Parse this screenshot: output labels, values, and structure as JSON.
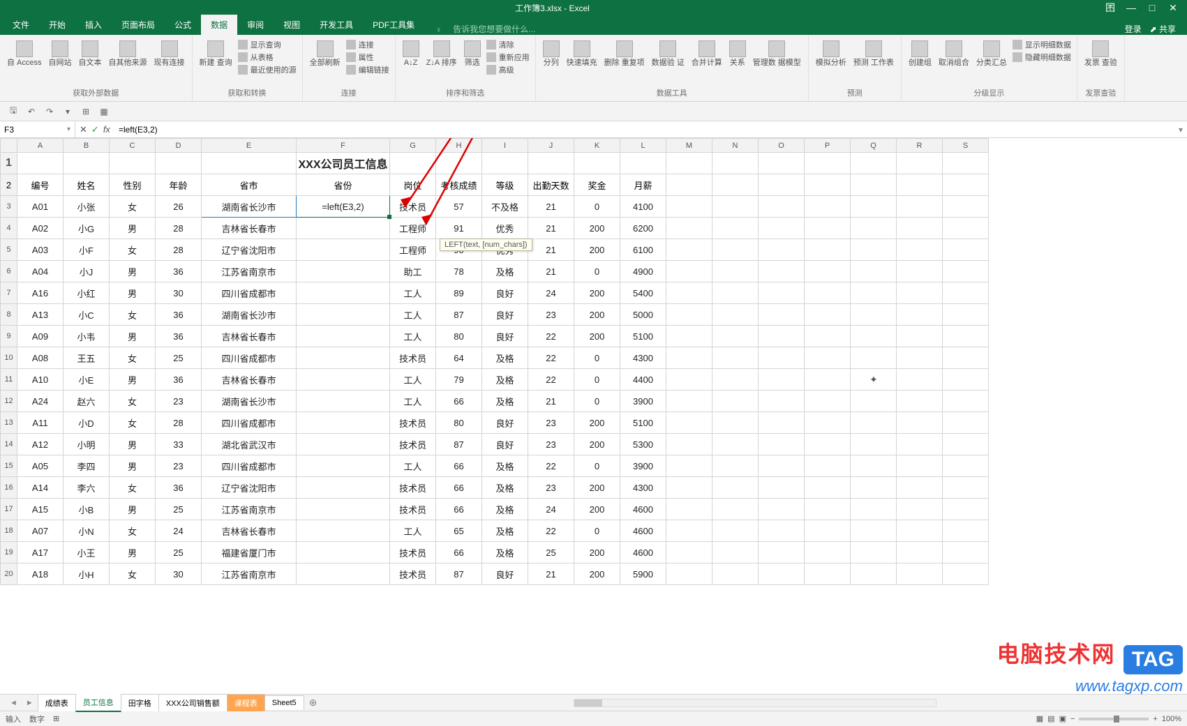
{
  "app_title": "工作簿3.xlsx - Excel",
  "title_left": [
    "日",
    "↶",
    "↷",
    "⇆",
    "▾"
  ],
  "win_controls": [
    "囨",
    "—",
    "□",
    "✕"
  ],
  "menu": {
    "items": [
      "文件",
      "开始",
      "插入",
      "页面布局",
      "公式",
      "数据",
      "审阅",
      "视图",
      "开发工具",
      "PDF工具集"
    ],
    "active": "数据",
    "tell_me_icon": "♀",
    "tell_me": "告诉我您想要做什么...",
    "right": [
      "登录",
      "⬈ 共享"
    ]
  },
  "ribbon_groups": [
    {
      "label": "获取外部数据",
      "items": [
        {
          "t": "big",
          "lbl": "自 Access"
        },
        {
          "t": "big",
          "lbl": "自网站"
        },
        {
          "t": "big",
          "lbl": "自文本"
        },
        {
          "t": "big",
          "lbl": "自其他来源"
        },
        {
          "t": "big",
          "lbl": "现有连接"
        }
      ]
    },
    {
      "label": "获取和转换",
      "items": [
        {
          "t": "big",
          "lbl": "新建\n查询"
        },
        {
          "t": "small",
          "lbls": [
            "显示查询",
            "从表格",
            "最近使用的源"
          ]
        }
      ]
    },
    {
      "label": "连接",
      "items": [
        {
          "t": "big",
          "lbl": "全部刷新"
        },
        {
          "t": "small",
          "lbls": [
            "连接",
            "属性",
            "编辑链接"
          ]
        }
      ]
    },
    {
      "label": "排序和筛选",
      "items": [
        {
          "t": "big",
          "lbl": "A↓Z"
        },
        {
          "t": "big",
          "lbl": "Z↓A\n排序"
        },
        {
          "t": "big",
          "lbl": "筛选"
        },
        {
          "t": "small",
          "lbls": [
            "清除",
            "重新应用",
            "高级"
          ]
        }
      ]
    },
    {
      "label": "数据工具",
      "items": [
        {
          "t": "big",
          "lbl": "分列"
        },
        {
          "t": "big",
          "lbl": "快速填充"
        },
        {
          "t": "big",
          "lbl": "删除\n重复项"
        },
        {
          "t": "big",
          "lbl": "数据验\n证"
        },
        {
          "t": "big",
          "lbl": "合并计算"
        },
        {
          "t": "big",
          "lbl": "关系"
        },
        {
          "t": "big",
          "lbl": "管理数\n据模型"
        }
      ]
    },
    {
      "label": "预测",
      "items": [
        {
          "t": "big",
          "lbl": "模拟分析"
        },
        {
          "t": "big",
          "lbl": "预测\n工作表"
        }
      ]
    },
    {
      "label": "分级显示",
      "items": [
        {
          "t": "big",
          "lbl": "创建组"
        },
        {
          "t": "big",
          "lbl": "取消组合"
        },
        {
          "t": "big",
          "lbl": "分类汇总"
        },
        {
          "t": "small",
          "lbls": [
            "显示明细数据",
            "隐藏明细数据"
          ]
        }
      ]
    },
    {
      "label": "发票查验",
      "items": [
        {
          "t": "big",
          "lbl": "发票\n查验"
        }
      ]
    }
  ],
  "qat": [
    "🖫",
    "↶",
    "↷",
    "▾",
    "⊞",
    "▦"
  ],
  "name_box": "F3",
  "fx_icons": {
    "cancel": "✕",
    "enter": "✓",
    "fx": "fx"
  },
  "formula": "=left(E3,2)",
  "columns": [
    "A",
    "B",
    "C",
    "D",
    "E",
    "F",
    "G",
    "H",
    "I",
    "J",
    "K",
    "L",
    "M",
    "N",
    "O",
    "P",
    "Q",
    "R",
    "S"
  ],
  "sheet_title": "XXX公司员工信息",
  "headers": [
    "编号",
    "姓名",
    "性别",
    "年龄",
    "省市",
    "省份",
    "岗位",
    "考核成绩",
    "等级",
    "出勤天数",
    "奖金",
    "月薪"
  ],
  "active_cell_display": "=left(E3,2)",
  "tooltip_text": "LEFT(text, [num_chars])",
  "rows": [
    [
      "A01",
      "小张",
      "女",
      "26",
      "湖南省长沙市",
      "",
      "技术员",
      "57",
      "不及格",
      "21",
      "0",
      "4100"
    ],
    [
      "A02",
      "小G",
      "男",
      "28",
      "吉林省长春市",
      "",
      "工程师",
      "91",
      "优秀",
      "21",
      "200",
      "6200"
    ],
    [
      "A03",
      "小F",
      "女",
      "28",
      "辽宁省沈阳市",
      "",
      "工程师",
      "90",
      "优秀",
      "21",
      "200",
      "6100"
    ],
    [
      "A04",
      "小J",
      "男",
      "36",
      "江苏省南京市",
      "",
      "助工",
      "78",
      "及格",
      "21",
      "0",
      "4900"
    ],
    [
      "A16",
      "小红",
      "男",
      "30",
      "四川省成都市",
      "",
      "工人",
      "89",
      "良好",
      "24",
      "200",
      "5400"
    ],
    [
      "A13",
      "小C",
      "女",
      "36",
      "湖南省长沙市",
      "",
      "工人",
      "87",
      "良好",
      "23",
      "200",
      "5000"
    ],
    [
      "A09",
      "小韦",
      "男",
      "36",
      "吉林省长春市",
      "",
      "工人",
      "80",
      "良好",
      "22",
      "200",
      "5100"
    ],
    [
      "A08",
      "王五",
      "女",
      "25",
      "四川省成都市",
      "",
      "技术员",
      "64",
      "及格",
      "22",
      "0",
      "4300"
    ],
    [
      "A10",
      "小E",
      "男",
      "36",
      "吉林省长春市",
      "",
      "工人",
      "79",
      "及格",
      "22",
      "0",
      "4400"
    ],
    [
      "A24",
      "赵六",
      "女",
      "23",
      "湖南省长沙市",
      "",
      "工人",
      "66",
      "及格",
      "21",
      "0",
      "3900"
    ],
    [
      "A11",
      "小D",
      "女",
      "28",
      "四川省成都市",
      "",
      "技术员",
      "80",
      "良好",
      "23",
      "200",
      "5100"
    ],
    [
      "A12",
      "小明",
      "男",
      "33",
      "湖北省武汉市",
      "",
      "技术员",
      "87",
      "良好",
      "23",
      "200",
      "5300"
    ],
    [
      "A05",
      "李四",
      "男",
      "23",
      "四川省成都市",
      "",
      "工人",
      "66",
      "及格",
      "22",
      "0",
      "3900"
    ],
    [
      "A14",
      "李六",
      "女",
      "36",
      "辽宁省沈阳市",
      "",
      "技术员",
      "66",
      "及格",
      "23",
      "200",
      "4300"
    ],
    [
      "A15",
      "小B",
      "男",
      "25",
      "江苏省南京市",
      "",
      "技术员",
      "66",
      "及格",
      "24",
      "200",
      "4600"
    ],
    [
      "A07",
      "小N",
      "女",
      "24",
      "吉林省长春市",
      "",
      "工人",
      "65",
      "及格",
      "22",
      "0",
      "4600"
    ],
    [
      "A17",
      "小王",
      "男",
      "25",
      "福建省厦门市",
      "",
      "技术员",
      "66",
      "及格",
      "25",
      "200",
      "4600"
    ],
    [
      "A18",
      "小H",
      "女",
      "30",
      "江苏省南京市",
      "",
      "技术员",
      "87",
      "良好",
      "21",
      "200",
      "5900"
    ]
  ],
  "tabs": {
    "nav": [
      "◄",
      "►"
    ],
    "items": [
      "成绩表",
      "员工信息",
      "田字格",
      "XXX公司销售额",
      "课程表",
      "Sheet5"
    ],
    "active": "员工信息",
    "orange": [
      "课程表"
    ]
  },
  "status": {
    "left": [
      "输入",
      "数字",
      "⊞"
    ],
    "zoom_minus": "−",
    "zoom_plus": "+",
    "zoom_pct": "100%",
    "views": [
      "▦",
      "▤",
      "▣"
    ]
  },
  "watermark": {
    "cn": "电脑技术网",
    "tag": "TAG",
    "url": "www.tagxp.com"
  },
  "cursor_pos": "✦"
}
